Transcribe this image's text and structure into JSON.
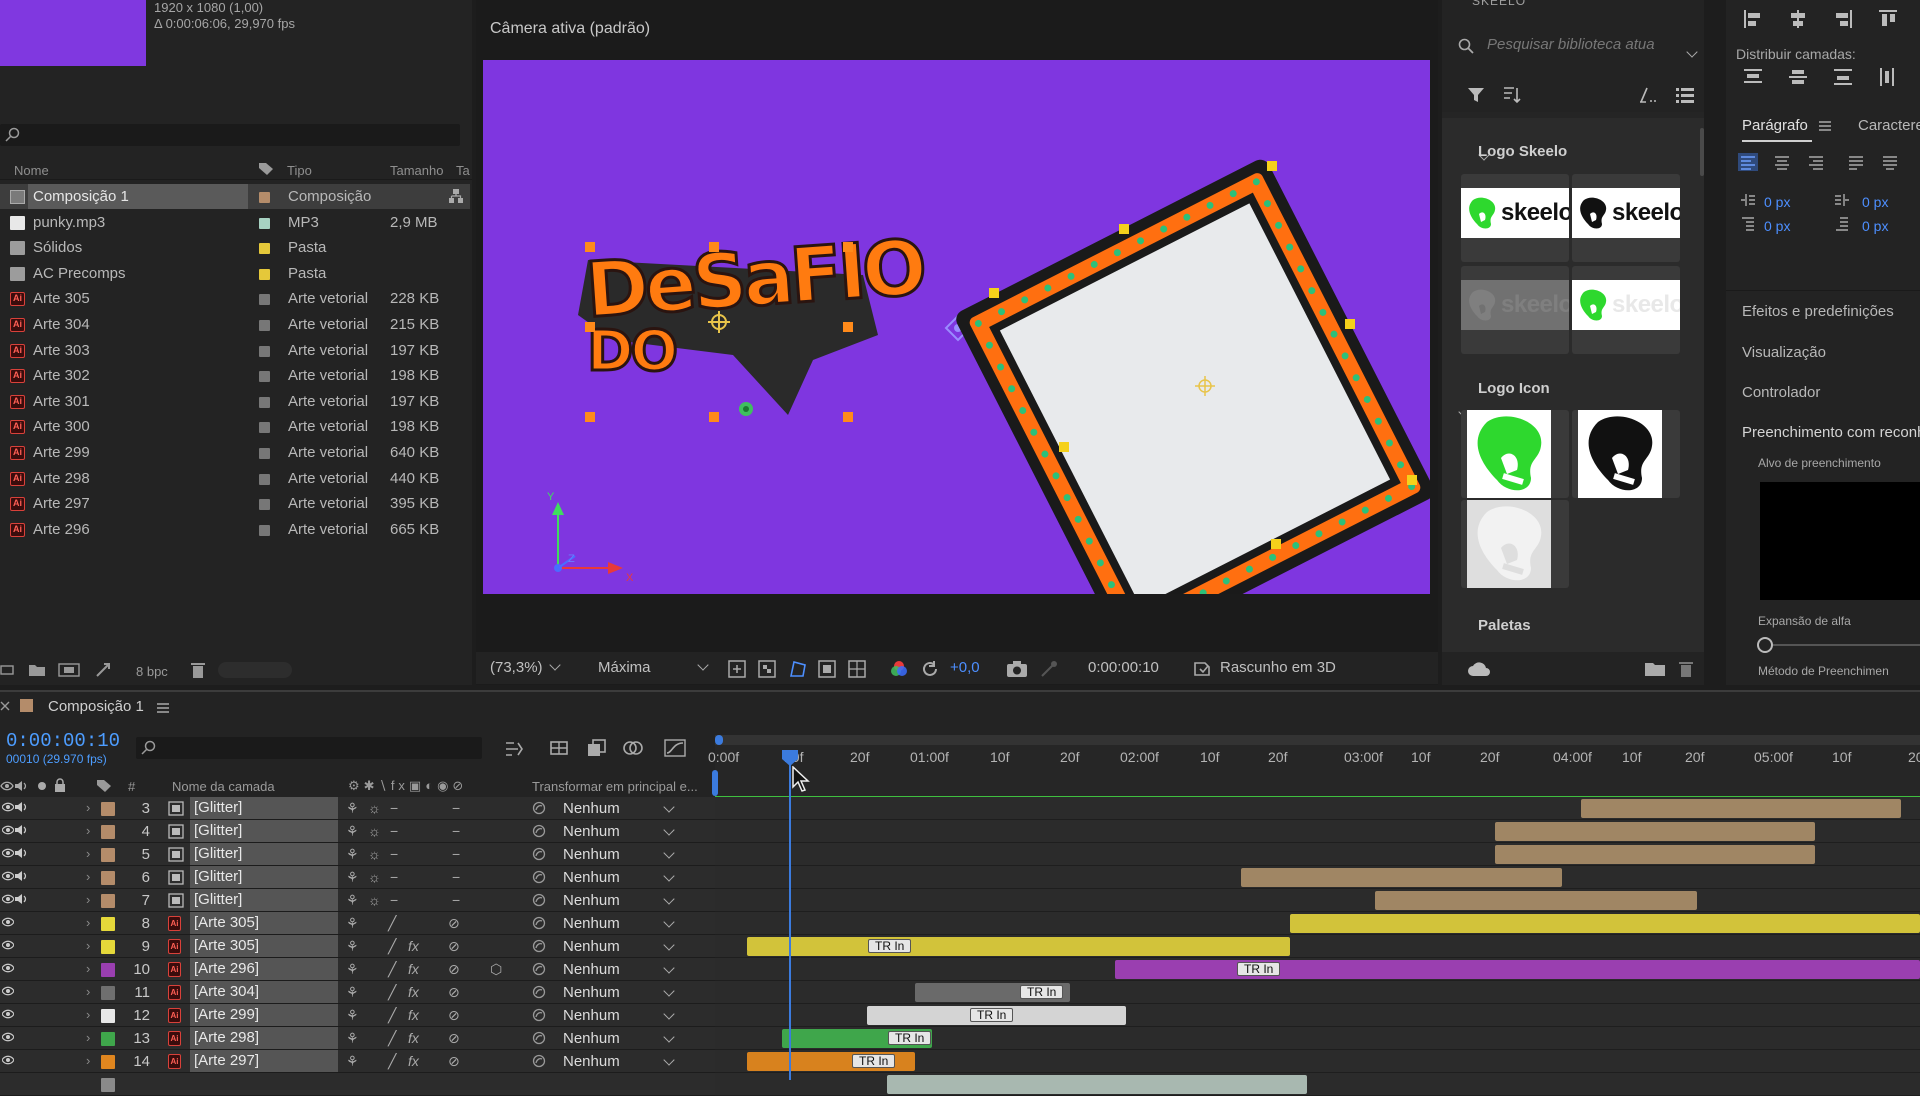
{
  "project": {
    "info_line1": "1920 x 1080 (1,00)",
    "info_line2": "Δ 0:00:06:06, 29,970 fps",
    "columns": {
      "name": "Nome",
      "type": "Tipo",
      "size": "Tamanho",
      "extra": "Ta"
    },
    "items": [
      {
        "name": "Composição 1",
        "type": "Composição",
        "size": "",
        "color": "#b48c6a",
        "icon": "composition-icon",
        "selected": true
      },
      {
        "name": "punky.mp3",
        "type": "MP3",
        "size": "2,9 MB",
        "color": "#a7d2c2",
        "icon": "audio-file-icon"
      },
      {
        "name": "Sólidos",
        "type": "Pasta",
        "size": "",
        "color": "#e5c83a",
        "icon": "folder-icon"
      },
      {
        "name": "AC Precomps",
        "type": "Pasta",
        "size": "",
        "color": "#e5c83a",
        "icon": "folder-icon"
      },
      {
        "name": "Arte 305",
        "type": "Arte vetorial",
        "size": "228 KB",
        "color": "#777777",
        "icon": "illustrator-file-icon"
      },
      {
        "name": "Arte 304",
        "type": "Arte vetorial",
        "size": "215 KB",
        "color": "#777777",
        "icon": "illustrator-file-icon"
      },
      {
        "name": "Arte 303",
        "type": "Arte vetorial",
        "size": "197 KB",
        "color": "#777777",
        "icon": "illustrator-file-icon"
      },
      {
        "name": "Arte 302",
        "type": "Arte vetorial",
        "size": "198 KB",
        "color": "#777777",
        "icon": "illustrator-file-icon"
      },
      {
        "name": "Arte 301",
        "type": "Arte vetorial",
        "size": "197 KB",
        "color": "#777777",
        "icon": "illustrator-file-icon"
      },
      {
        "name": "Arte 300",
        "type": "Arte vetorial",
        "size": "198 KB",
        "color": "#777777",
        "icon": "illustrator-file-icon"
      },
      {
        "name": "Arte 299",
        "type": "Arte vetorial",
        "size": "640 KB",
        "color": "#777777",
        "icon": "illustrator-file-icon"
      },
      {
        "name": "Arte 298",
        "type": "Arte vetorial",
        "size": "440 KB",
        "color": "#777777",
        "icon": "illustrator-file-icon"
      },
      {
        "name": "Arte 297",
        "type": "Arte vetorial",
        "size": "395 KB",
        "color": "#777777",
        "icon": "illustrator-file-icon"
      },
      {
        "name": "Arte 296",
        "type": "Arte vetorial",
        "size": "665 KB",
        "color": "#777777",
        "icon": "illustrator-file-icon"
      }
    ],
    "bpc": "8 bpc"
  },
  "viewer": {
    "title": "Câmera ativa (padrão)",
    "artwork_text_line1": "DeSaFIO",
    "artwork_text_line2": "DO",
    "zoom": "(73,3%)",
    "resolution": "Máxima",
    "exposure": "+0,0",
    "timecode": "0:00:00:10",
    "renderer": "Rascunho em 3D",
    "axis_y": "Y",
    "axis_z": "Z",
    "axis_x": "X"
  },
  "skeelo": {
    "title": "SKEELO",
    "search_placeholder": "Pesquisar biblioteca atua",
    "sections": [
      "Logo Skeelo",
      "Logo Icon",
      "Paletas"
    ],
    "logo_word": "skeelo"
  },
  "right_panel": {
    "distribute_label": "Distribuir camadas:",
    "tab_paragraph": "Parágrafo",
    "tab_character": "Caractere",
    "indent_values": [
      "0 px",
      "0 px",
      "0 px",
      "0 px"
    ],
    "effects": "Efeitos e predefinições",
    "preview": "Visualização",
    "controller": "Controlador",
    "fill": "Preenchimento com reconh",
    "fill_target": "Alvo de preenchimento",
    "alpha_expansion": "Expansão de alfa",
    "fill_method": "Método de Preenchimen"
  },
  "timeline": {
    "tab": "Composição 1",
    "timecode": "0:00:00:10",
    "timecode_sub": "00010 (29.970 fps)",
    "col_num": "#",
    "col_name": "Nome da camada",
    "col_parent": "Transformar em principal e...",
    "ruler": [
      "0:00f",
      "10f",
      "20f",
      "01:00f",
      "10f",
      "20f",
      "02:00f",
      "10f",
      "20f",
      "03:00f",
      "10f",
      "20f",
      "04:00f",
      "10f",
      "20f",
      "05:00f",
      "10f",
      "20"
    ],
    "layers": [
      {
        "num": "3",
        "name": "[Glitter]",
        "color": "#b48c6a",
        "parent": "Nenhum",
        "kind": "comp"
      },
      {
        "num": "4",
        "name": "[Glitter]",
        "color": "#b48c6a",
        "parent": "Nenhum",
        "kind": "comp"
      },
      {
        "num": "5",
        "name": "[Glitter]",
        "color": "#b48c6a",
        "parent": "Nenhum",
        "kind": "comp"
      },
      {
        "num": "6",
        "name": "[Glitter]",
        "color": "#b48c6a",
        "parent": "Nenhum",
        "kind": "comp"
      },
      {
        "num": "7",
        "name": "[Glitter]",
        "color": "#b48c6a",
        "parent": "Nenhum",
        "kind": "comp"
      },
      {
        "num": "8",
        "name": "[Arte 305]",
        "color": "#e5d83a",
        "parent": "Nenhum",
        "kind": "ai"
      },
      {
        "num": "9",
        "name": "[Arte 305]",
        "color": "#e5d83a",
        "parent": "Nenhum",
        "kind": "ai"
      },
      {
        "num": "10",
        "name": "[Arte 296]",
        "color": "#9a3fb0",
        "parent": "Nenhum",
        "kind": "ai"
      },
      {
        "num": "11",
        "name": "[Arte 304]",
        "color": "#6f6f6f",
        "parent": "Nenhum",
        "kind": "ai"
      },
      {
        "num": "12",
        "name": "[Arte 299]",
        "color": "#e8e8e8",
        "parent": "Nenhum",
        "kind": "ai"
      },
      {
        "num": "13",
        "name": "[Arte 298]",
        "color": "#3fa64b",
        "parent": "Nenhum",
        "kind": "ai"
      },
      {
        "num": "14",
        "name": "[Arte 297]",
        "color": "#e0861f",
        "parent": "Nenhum",
        "kind": "ai"
      }
    ],
    "marker_label": "TR In"
  }
}
